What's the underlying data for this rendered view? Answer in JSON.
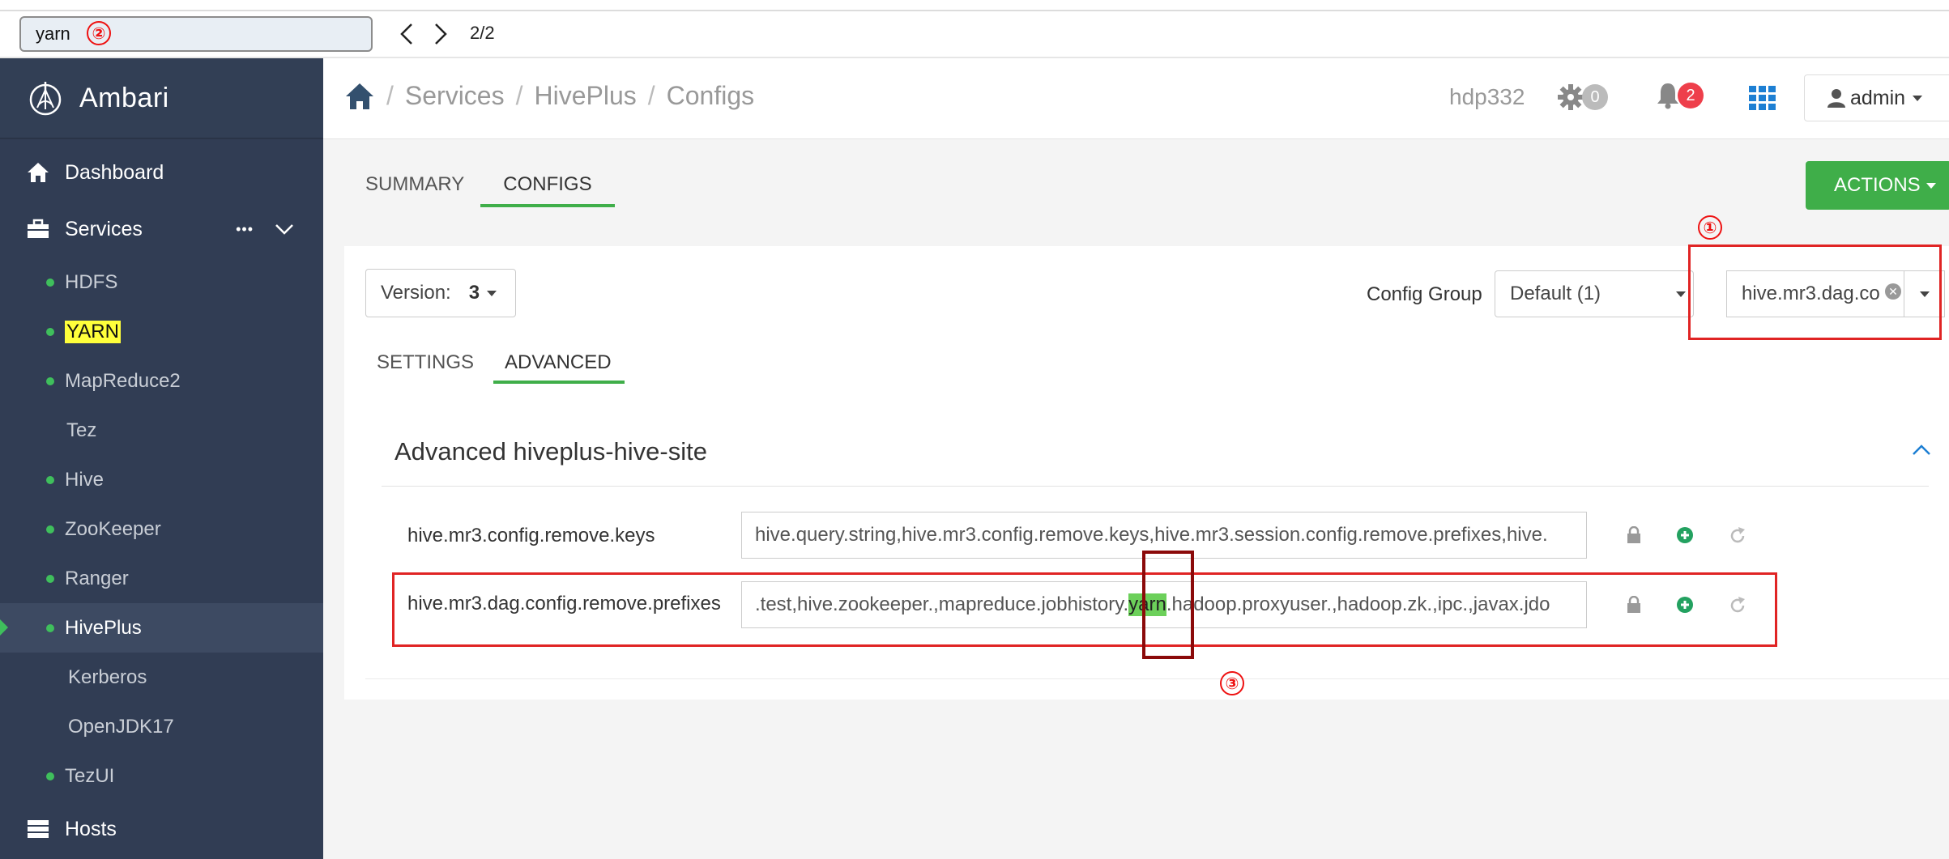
{
  "find": {
    "query": "yarn",
    "marker": "②",
    "count": "2/2"
  },
  "sidebar": {
    "brand": "Ambari",
    "dashboard": "Dashboard",
    "services": "Services",
    "more": "•••",
    "services_list": [
      {
        "label": "HDFS",
        "status": true
      },
      {
        "label": "YARN",
        "status": true,
        "highlighted": true
      },
      {
        "label": "MapReduce2",
        "status": true
      },
      {
        "label": "Tez",
        "status": false
      },
      {
        "label": "Hive",
        "status": true
      },
      {
        "label": "ZooKeeper",
        "status": true
      },
      {
        "label": "Ranger",
        "status": true
      },
      {
        "label": "HivePlus",
        "status": true,
        "active": true
      },
      {
        "label": "Kerberos",
        "status": false
      },
      {
        "label": "OpenJDK17",
        "status": false
      },
      {
        "label": "TezUI",
        "status": true
      }
    ],
    "hosts": "Hosts"
  },
  "header": {
    "breadcrumb": [
      "Services",
      "HivePlus",
      "Configs"
    ],
    "sep": "/",
    "cluster": "hdp332",
    "ops_count": "0",
    "alerts_count": "2",
    "user": "admin"
  },
  "tabs": {
    "summary": "SUMMARY",
    "configs": "CONFIGS"
  },
  "actions": "ACTIONS",
  "config": {
    "version_label": "Version:",
    "version_value": "3",
    "group_label": "Config Group",
    "group_value": "Default (1)",
    "filter_value": "hive.mr3.dag.co",
    "subtabs": {
      "settings": "SETTINGS",
      "advanced": "ADVANCED"
    },
    "section_title": "Advanced hiveplus-hive-site",
    "props": [
      {
        "name": "hive.mr3.config.remove.keys",
        "value": "hive.query.string,hive.mr3.config.remove.keys,hive.mr3.session.config.remove.prefixes,hive."
      },
      {
        "name": "hive.mr3.dag.config.remove.prefixes",
        "value_before": ".test,hive.zookeeper.,mapreduce.jobhistory.",
        "value_match": "yarn",
        "value_after": ".hadoop.proxyuser.,hadoop.zk.,ipc.,javax.jdo"
      }
    ]
  },
  "annotations": {
    "one": "①",
    "three": "③"
  },
  "colors": {
    "sidebar": "#313d54",
    "accent_green": "#3fae49",
    "annotation_red": "#e02424",
    "match_yellow": "#ffff3b",
    "match_green": "#6cd05a"
  }
}
